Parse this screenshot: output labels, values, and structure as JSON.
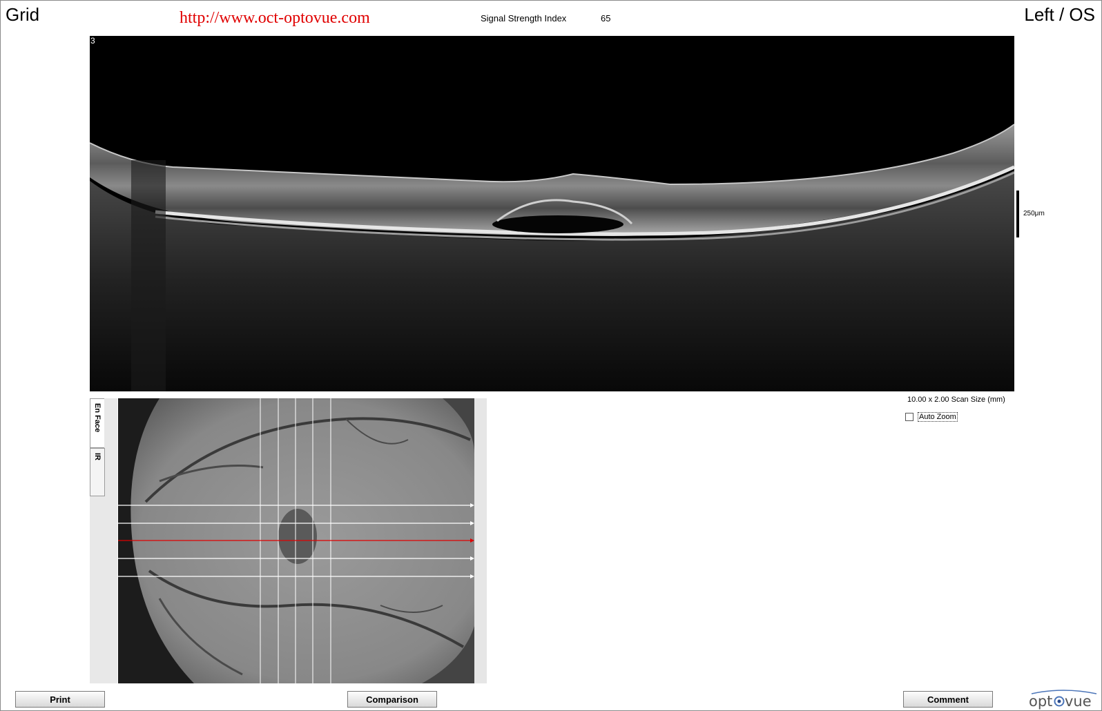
{
  "header": {
    "title": "Grid",
    "url": "http://www.oct-optovue.com",
    "signal_strength_label": "Signal Strength Index",
    "signal_strength_value": "65",
    "eye": "Left / OS"
  },
  "bscan": {
    "scan_index": "3",
    "scale_label": "250μm",
    "scan_size": "10.00 x 2.00 Scan Size (mm)",
    "auto_zoom_label": "Auto Zoom",
    "auto_zoom_checked": false
  },
  "side_tabs": [
    {
      "label": "En Face",
      "active": true
    },
    {
      "label": "IR",
      "active": false
    }
  ],
  "buttons": {
    "print": "Print",
    "comparison": "Comparison",
    "comment": "Comment"
  },
  "logo_text": "optovue",
  "colors": {
    "url_red": "#e00000",
    "selected_scan_line": "#e00000",
    "scan_line": "#ffffff"
  }
}
